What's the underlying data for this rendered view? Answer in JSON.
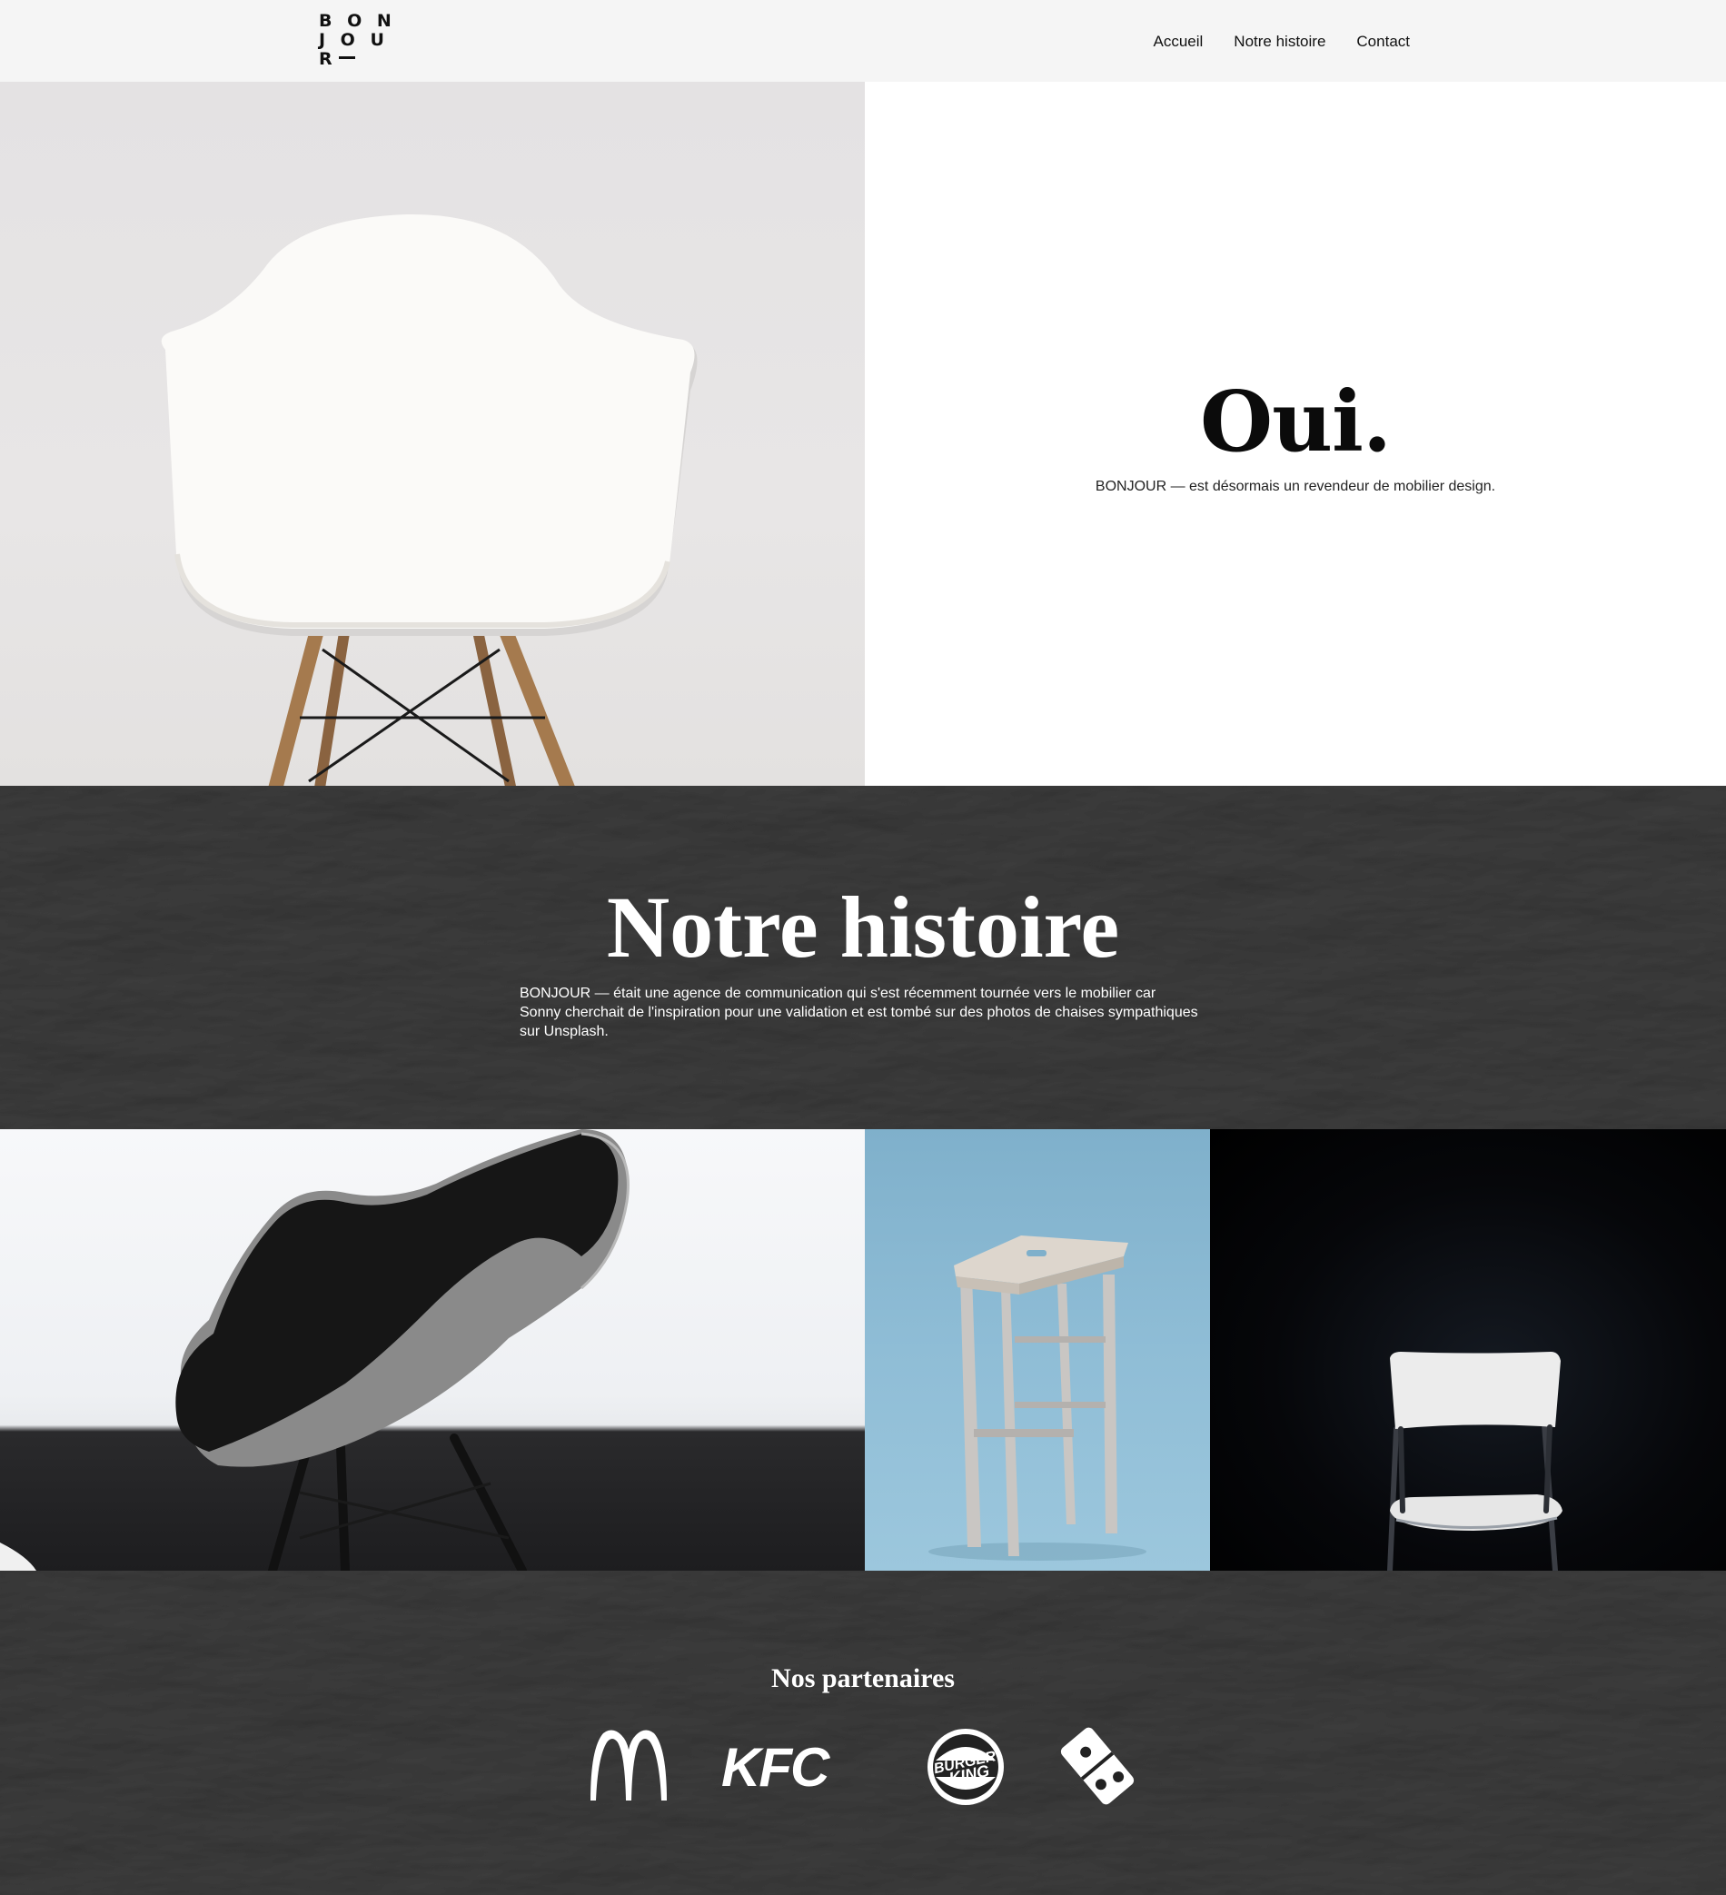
{
  "header": {
    "logo_rows": [
      "B O N",
      "J O U",
      "R"
    ],
    "nav": [
      "Accueil",
      "Notre histoire",
      "Contact"
    ]
  },
  "hero": {
    "title": "Oui.",
    "subtitle": "BONJOUR — est désormais un revendeur de mobilier design."
  },
  "story": {
    "title": "Notre histoire",
    "body": "BONJOUR — était une agence de communication qui s'est récemment tournée vers le mobilier car Sonny cherchait de l'inspiration pour une validation et est tombé sur des photos de chaises sympathiques sur Unsplash."
  },
  "partners": {
    "title": "Nos partenaires",
    "logos": [
      "McDonald's",
      "KFC",
      "Burger King",
      "Domino's"
    ],
    "kfc_text": "KFC",
    "bk_text_1": "BURGER",
    "bk_text_2": "KING"
  },
  "colors": {
    "header_bg": "#f5f5f5",
    "band_bg": "#222222",
    "hero_text_bg": "#ffffff"
  }
}
